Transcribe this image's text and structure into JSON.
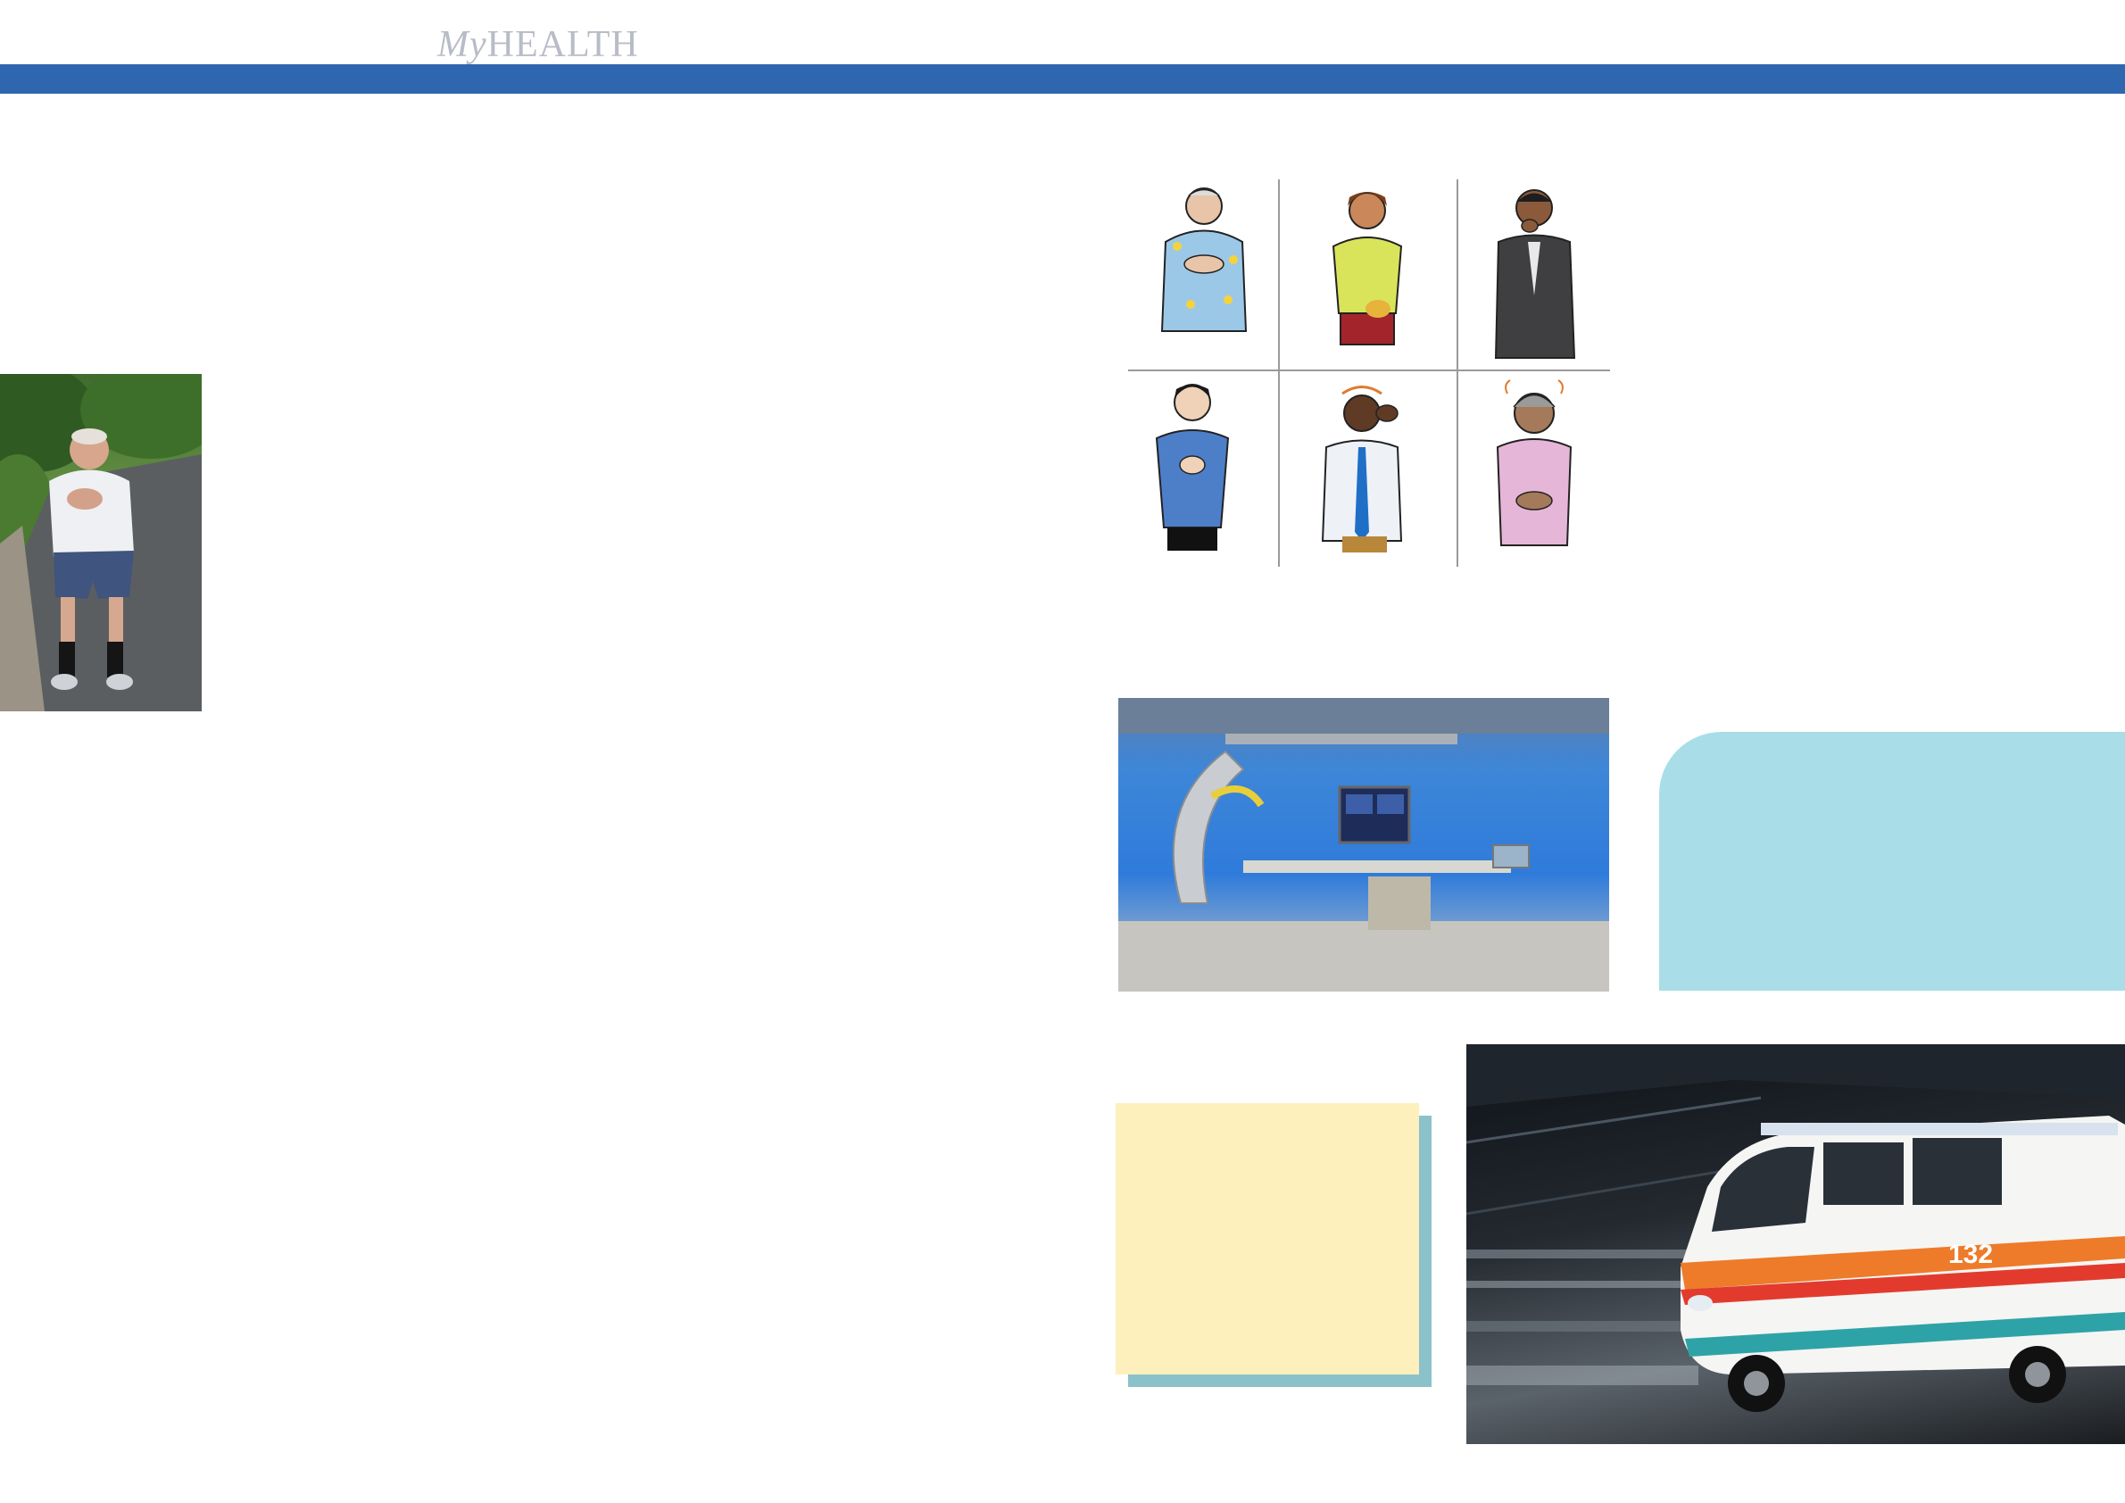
{
  "header": {
    "brand_prefix": "My",
    "brand_name": "HEALTH",
    "band_color": "#2f66b0"
  },
  "images": {
    "man_photo": "man-clutching-chest-photo",
    "symptoms_grid": "heart-attack-symptoms-illustration",
    "cath_lab": "catheterization-lab-photo",
    "ambulance": "ambulance-photo"
  },
  "ambulance": {
    "vehicle_number": "132"
  },
  "panels": {
    "blue_panel_color": "#a9dde8",
    "note_color": "#fdf0bd",
    "note_shadow_color": "#8bc2c9"
  }
}
